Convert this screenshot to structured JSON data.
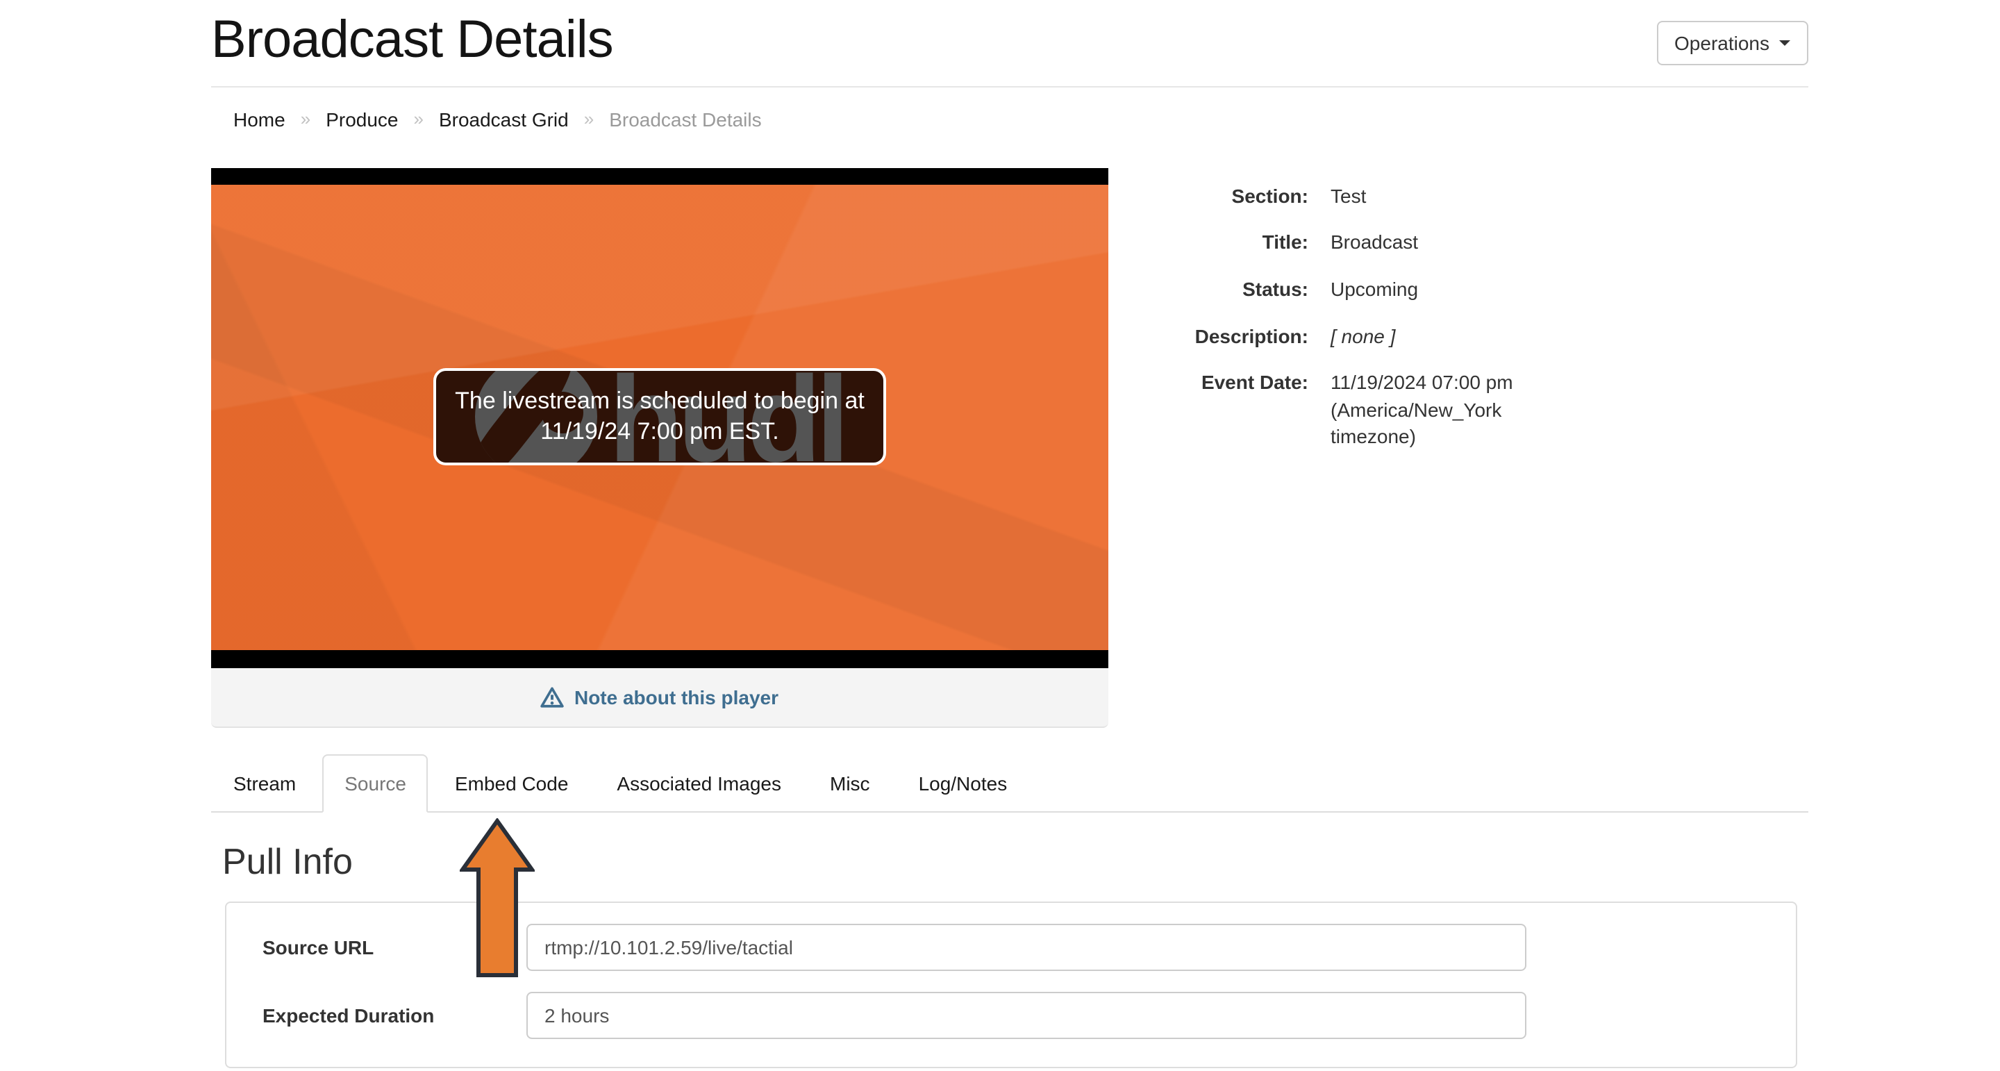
{
  "page": {
    "title": "Broadcast Details"
  },
  "toolbar": {
    "operations_label": "Operations"
  },
  "breadcrumb": {
    "separator": "»",
    "items": [
      {
        "label": "Home"
      },
      {
        "label": "Produce"
      },
      {
        "label": "Broadcast Grid"
      }
    ],
    "current": "Broadcast Details"
  },
  "player": {
    "message_line1": "The livestream is scheduled to begin at",
    "message_line2": "11/19/24 7:00 pm EST.",
    "watermark_brand": "hudl",
    "note_link_label": "Note about this player"
  },
  "details": {
    "rows": [
      {
        "label": "Section:",
        "value": "Test"
      },
      {
        "label": "Title:",
        "value": "Broadcast"
      },
      {
        "label": "Status:",
        "value": "Upcoming"
      },
      {
        "label": "Description:",
        "value": "[ none ]"
      },
      {
        "label": "Event Date:",
        "value": "11/19/2024 07:00 pm (America/New_York timezone)"
      }
    ]
  },
  "tabs": {
    "items": [
      {
        "label": "Stream",
        "active": false
      },
      {
        "label": "Source",
        "active": true
      },
      {
        "label": "Embed Code",
        "active": false
      },
      {
        "label": "Associated Images",
        "active": false
      },
      {
        "label": "Misc",
        "active": false
      },
      {
        "label": "Log/Notes",
        "active": false
      }
    ]
  },
  "pull_info": {
    "heading": "Pull Info",
    "fields": [
      {
        "label": "Source URL",
        "value": "rtmp://10.101.2.59/live/tactial"
      },
      {
        "label": "Expected Duration",
        "value": "2 hours"
      }
    ]
  },
  "colors": {
    "player_orange": "#ec6c2d",
    "message_box_brown": "#2e1207",
    "note_link_blue": "#3f6e90",
    "annotation_arrow_fill": "#e87d2f",
    "annotation_arrow_outline": "#2a2f38"
  }
}
